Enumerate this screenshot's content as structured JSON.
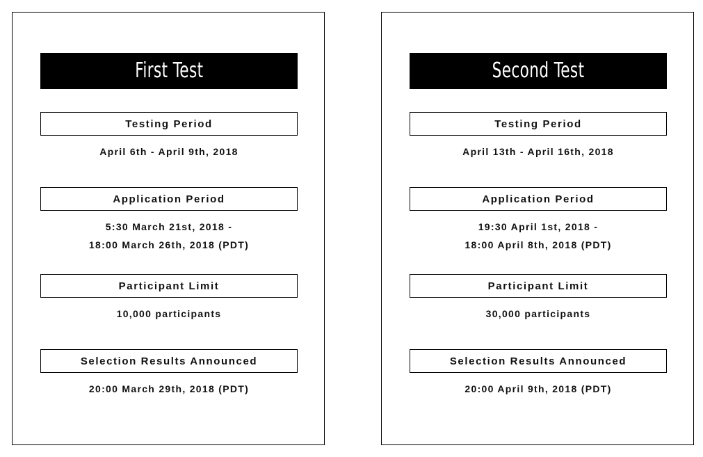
{
  "page": {
    "background_color": "#ffffff",
    "border_color": "#000000",
    "text_color": "#101010",
    "title_bar_color": "#000000",
    "title_text_color": "#ffffff"
  },
  "cards": [
    {
      "title": "First Test",
      "sections": [
        {
          "label": "Testing Period",
          "lines": [
            "April 6th - April 9th, 2018"
          ]
        },
        {
          "label": "Application Period",
          "lines": [
            "5:30 March 21st, 2018 -",
            "18:00 March 26th, 2018 (PDT)"
          ]
        },
        {
          "label": "Participant Limit",
          "lines": [
            "10,000 participants"
          ]
        },
        {
          "label": "Selection Results Announced",
          "lines": [
            "20:00 March 29th, 2018 (PDT)"
          ]
        }
      ]
    },
    {
      "title": "Second Test",
      "sections": [
        {
          "label": "Testing Period",
          "lines": [
            "April 13th - April 16th, 2018"
          ]
        },
        {
          "label": "Application Period",
          "lines": [
            "19:30 April 1st, 2018 -",
            "18:00 April 8th, 2018 (PDT)"
          ]
        },
        {
          "label": "Participant Limit",
          "lines": [
            "30,000 participants"
          ]
        },
        {
          "label": "Selection Results Announced",
          "lines": [
            "20:00 April 9th, 2018 (PDT)"
          ]
        }
      ]
    }
  ]
}
